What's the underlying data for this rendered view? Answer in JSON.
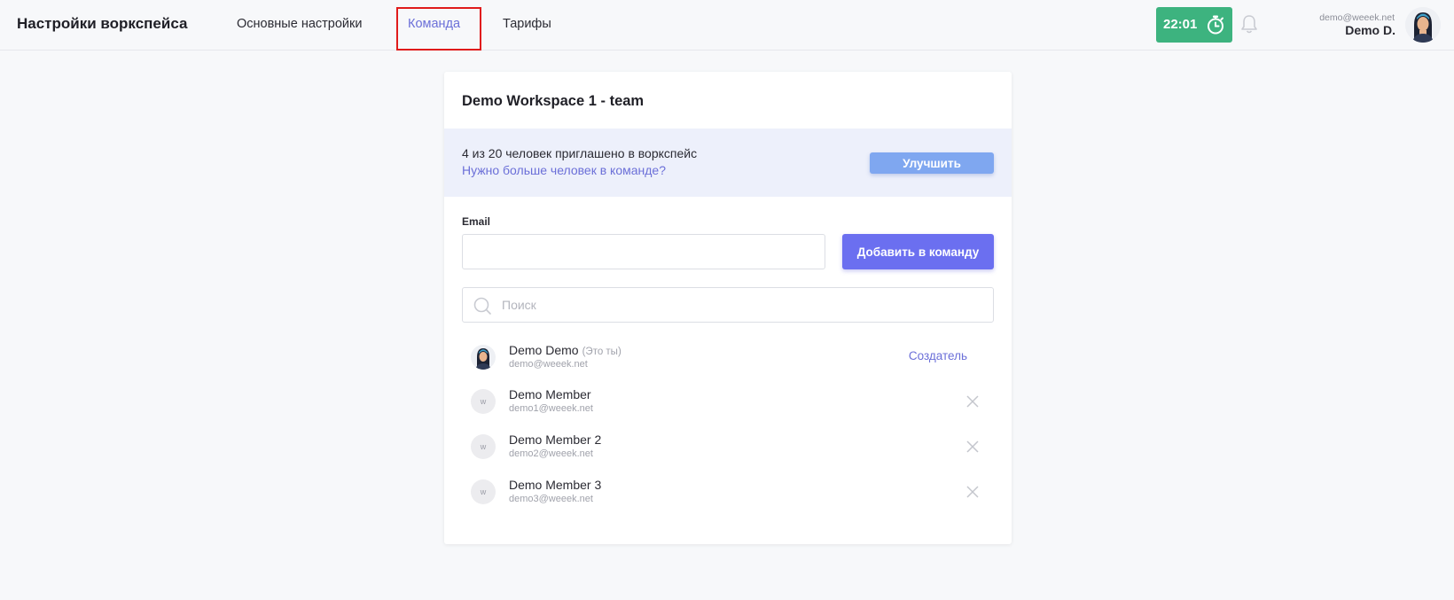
{
  "header": {
    "app_title": "Настройки воркспейса",
    "tabs": [
      {
        "label": "Основные настройки",
        "active": false
      },
      {
        "label": "Команда",
        "active": true
      },
      {
        "label": "Тарифы",
        "active": false
      }
    ],
    "timer": {
      "value": "22:01",
      "icon": "stopwatch-icon",
      "color": "#3db37f"
    },
    "notifications_icon": "bell-icon",
    "user": {
      "email": "demo@weeek.net",
      "name": "Demo D."
    }
  },
  "card": {
    "title": "Demo Workspace 1 - team",
    "banner": {
      "count_text": "4 из 20 человек приглашено в воркспейс",
      "link_text": "Нужно больше человек в команде?",
      "upgrade_label": "Улучшить"
    },
    "invite": {
      "email_label": "Email",
      "email_value": "",
      "add_label": "Добавить в команду"
    },
    "search": {
      "placeholder": "Поиск",
      "value": ""
    },
    "members": [
      {
        "name": "Demo Demo",
        "you_label": "(Это ты)",
        "email": "demo@weeek.net",
        "role": "Создатель",
        "avatar_letter": ""
      },
      {
        "name": "Demo Member",
        "email": "demo1@weeek.net",
        "avatar_letter": "w"
      },
      {
        "name": "Demo Member 2",
        "email": "demo2@weeek.net",
        "avatar_letter": "w"
      },
      {
        "name": "Demo Member 3",
        "email": "demo3@weeek.net",
        "avatar_letter": "w"
      }
    ]
  },
  "colors": {
    "accent": "#6b6fd8",
    "primary_button": "#6b6ff0",
    "upgrade_button": "#7fa7f0",
    "banner_bg": "#edf0fb",
    "highlight_box": "#e01b1b"
  }
}
